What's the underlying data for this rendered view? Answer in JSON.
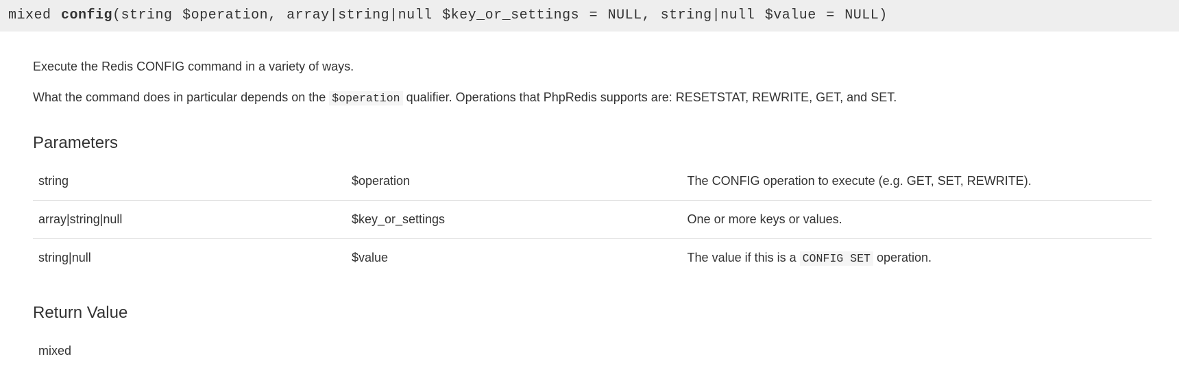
{
  "method": {
    "return_type": "mixed",
    "name": "config",
    "params_sig": [
      {
        "type": "string",
        "name": "$operation",
        "default": null
      },
      {
        "type": "array|string|null",
        "name": "$key_or_settings",
        "default": "NULL"
      },
      {
        "type": "string|null",
        "name": "$value",
        "default": "NULL"
      }
    ]
  },
  "description": {
    "p1": "Execute the Redis CONFIG command in a variety of ways.",
    "p2_pre": "What the command does in particular depends on the ",
    "p2_code": "$operation",
    "p2_post": " qualifier. Operations that PhpRedis supports are: RESETSTAT, REWRITE, GET, and SET."
  },
  "headings": {
    "parameters": "Parameters",
    "return_value": "Return Value"
  },
  "parameters": [
    {
      "type": "string",
      "name": "$operation",
      "desc": "The CONFIG operation to execute (e.g. GET, SET, REWRITE)."
    },
    {
      "type": "array|string|null",
      "name": "$key_or_settings",
      "desc": "One or more keys or values."
    },
    {
      "type": "string|null",
      "name": "$value",
      "desc_pre": "The value if this is a ",
      "desc_code": "CONFIG SET",
      "desc_post": " operation."
    }
  ],
  "return_value": {
    "type": "mixed"
  }
}
